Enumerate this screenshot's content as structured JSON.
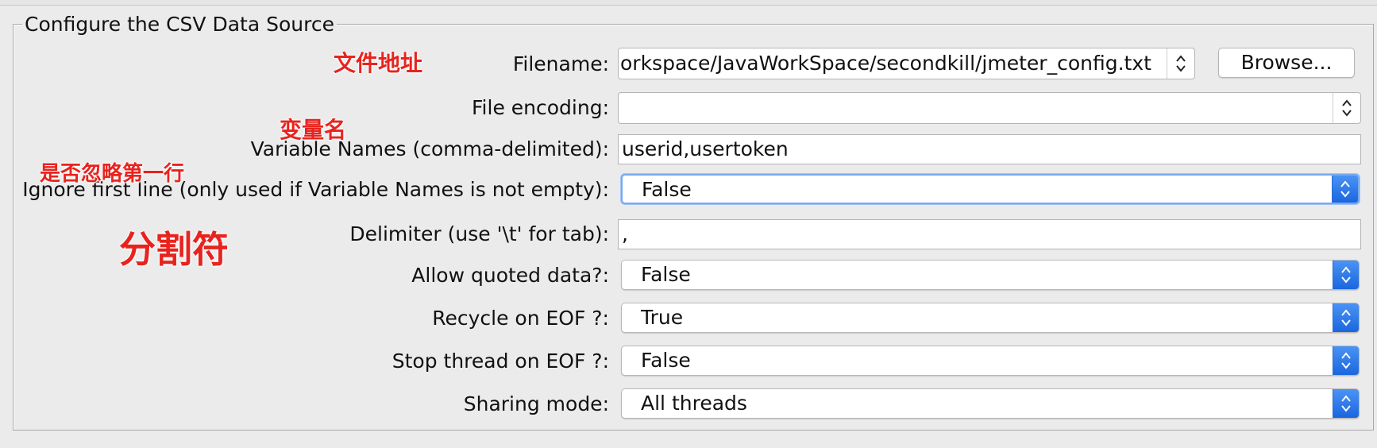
{
  "group": {
    "title": "Configure the CSV Data Source"
  },
  "rows": {
    "filename": {
      "label": "Filename:",
      "value": "orkspace/JavaWorkSpace/secondkill/jmeter_config.txt"
    },
    "encoding": {
      "label": "File encoding:",
      "value": ""
    },
    "varnames": {
      "label": "Variable Names (comma-delimited):",
      "value": "userid,usertoken"
    },
    "ignore": {
      "label": "Ignore first line (only used if Variable Names is not empty):",
      "value": "False"
    },
    "delimiter": {
      "label": "Delimiter (use '\\t' for tab):",
      "value": ","
    },
    "quoted": {
      "label": "Allow quoted data?:",
      "value": "False"
    },
    "recycle": {
      "label": "Recycle on EOF ?:",
      "value": "True"
    },
    "stopthread": {
      "label": "Stop thread on EOF ?:",
      "value": "False"
    },
    "sharing": {
      "label": "Sharing mode:",
      "value": "All threads"
    }
  },
  "browse_label": "Browse...",
  "annotations": {
    "file_address": "文件地址",
    "var_name": "变量名",
    "ignore_first": "是否忽略第一行",
    "delimiter": "分割符"
  },
  "colors": {
    "annotation": "#e8231e",
    "accent": "#1a66df"
  },
  "icons": {
    "stepper": "up-down-chevron-icon",
    "combo": "blue-chevron-icon"
  }
}
